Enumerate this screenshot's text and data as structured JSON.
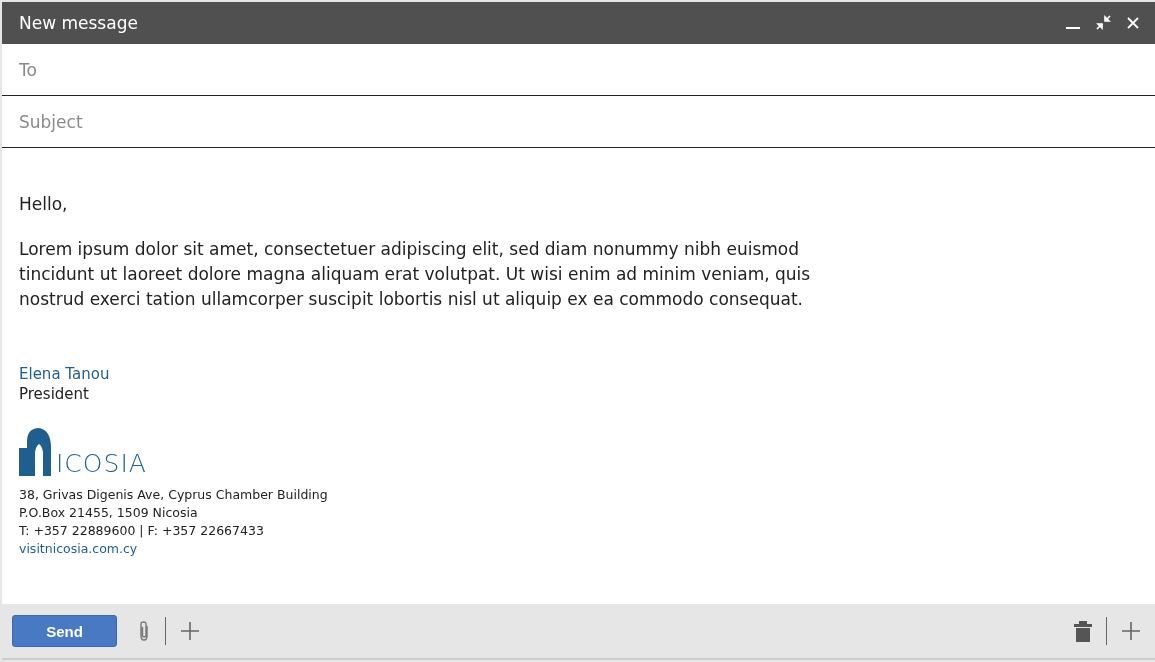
{
  "window": {
    "title": "New message"
  },
  "fields": [
    {
      "placeholder": "To"
    },
    {
      "placeholder": "Subject"
    }
  ],
  "body": {
    "greeting": "Hello,",
    "paragraphs": [
      "Lorem ipsum dolor sit amet, consectetuer adipiscing elit, sed diam nonummy nibh euismod tincidunt ut laoreet dolore magna aliquam erat volutpat. Ut wisi enim ad minim veniam, quis nostrud exerci tation ullamcorper suscipit lobortis nisl ut aliquip ex ea commodo consequat."
    ]
  },
  "signature": {
    "name": "Elena Tanou",
    "title": "President",
    "logo_text": "ICOSIA",
    "address_lines": [
      "38, Grivas Digenis Ave, Cyprus Chamber Building",
      "P.O.Box 21455, 1509 Nicosia",
      "T: +357 22889600 | F: +357 22667433"
    ],
    "website": "visitnicosia.com.cy"
  },
  "toolbar": {
    "send": "Send"
  }
}
